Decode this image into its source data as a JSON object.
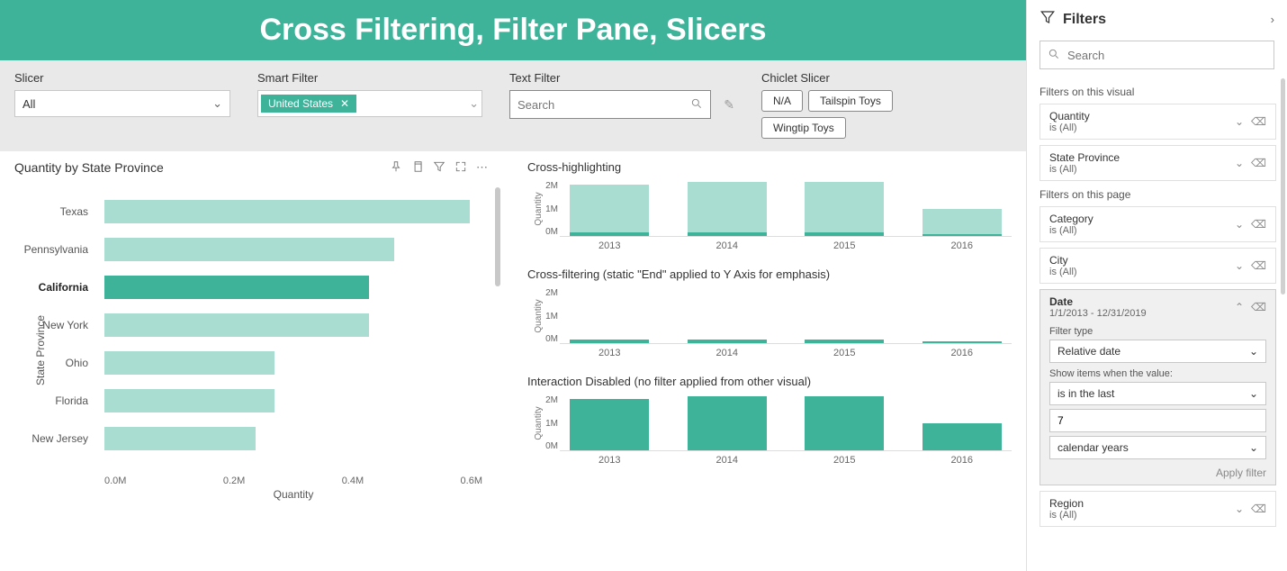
{
  "title": "Cross Filtering, Filter Pane, Slicers",
  "slicers": {
    "slicer_label": "Slicer",
    "slicer_value": "All",
    "smart_label": "Smart Filter",
    "smart_chip": "United States",
    "text_label": "Text Filter",
    "text_placeholder": "Search",
    "chiclet_label": "Chiclet Slicer",
    "chiclets": [
      "N/A",
      "Tailspin Toys",
      "Wingtip Toys"
    ]
  },
  "left_chart": {
    "title": "Quantity by State Province",
    "xlabel": "Quantity",
    "ylabel": "State Province",
    "ticks": [
      "0.0M",
      "0.2M",
      "0.4M",
      "0.6M"
    ]
  },
  "chart_data": [
    {
      "type": "bar",
      "orientation": "horizontal",
      "title": "Quantity by State Province",
      "xlabel": "Quantity",
      "ylabel": "State Province",
      "xlim": [
        0,
        0.6
      ],
      "categories": [
        "Texas",
        "Pennsylvania",
        "California",
        "New York",
        "Ohio",
        "Florida",
        "New Jersey"
      ],
      "values": [
        0.58,
        0.46,
        0.42,
        0.42,
        0.27,
        0.27,
        0.24
      ],
      "highlight_index": 2
    },
    {
      "type": "bar",
      "title": "Cross-highlighting",
      "ylabel": "Quantity",
      "ylim": [
        0,
        2.5
      ],
      "yticks": [
        "0M",
        "1M",
        "2M"
      ],
      "categories": [
        "2013",
        "2014",
        "2015",
        "2016"
      ],
      "values": [
        2.3,
        2.4,
        2.4,
        1.2
      ],
      "highlight_values": [
        0.15,
        0.15,
        0.15,
        0.08
      ]
    },
    {
      "type": "bar",
      "title": "Cross-filtering (static \"End\" applied to Y Axis for emphasis)",
      "ylabel": "Quantity",
      "ylim": [
        0,
        2.5
      ],
      "yticks": [
        "0M",
        "1M",
        "2M"
      ],
      "categories": [
        "2013",
        "2014",
        "2015",
        "2016"
      ],
      "values": [
        0.15,
        0.15,
        0.15,
        0.08
      ]
    },
    {
      "type": "bar",
      "title": "Interaction Disabled (no filter applied from other visual)",
      "ylabel": "Quantity",
      "ylim": [
        0,
        2.5
      ],
      "yticks": [
        "0M",
        "1M",
        "2M"
      ],
      "categories": [
        "2013",
        "2014",
        "2015",
        "2016"
      ],
      "values": [
        2.3,
        2.4,
        2.4,
        1.2
      ]
    }
  ],
  "filters_pane": {
    "header": "Filters",
    "search_placeholder": "Search",
    "visual_section": "Filters on this visual",
    "page_section": "Filters on this page",
    "cards": {
      "quantity": {
        "name": "Quantity",
        "val": "is (All)"
      },
      "state": {
        "name": "State Province",
        "val": "is (All)"
      },
      "category": {
        "name": "Category",
        "val": "is (All)"
      },
      "city": {
        "name": "City",
        "val": "is (All)"
      },
      "date": {
        "name": "Date",
        "val": "1/1/2013 - 12/31/2019"
      },
      "region": {
        "name": "Region",
        "val": "is (All)"
      }
    },
    "date_filter": {
      "type_label": "Filter type",
      "type_value": "Relative date",
      "show_label": "Show items when the value:",
      "op_value": "is in the last",
      "num_value": "7",
      "unit_value": "calendar years",
      "apply": "Apply filter"
    }
  }
}
